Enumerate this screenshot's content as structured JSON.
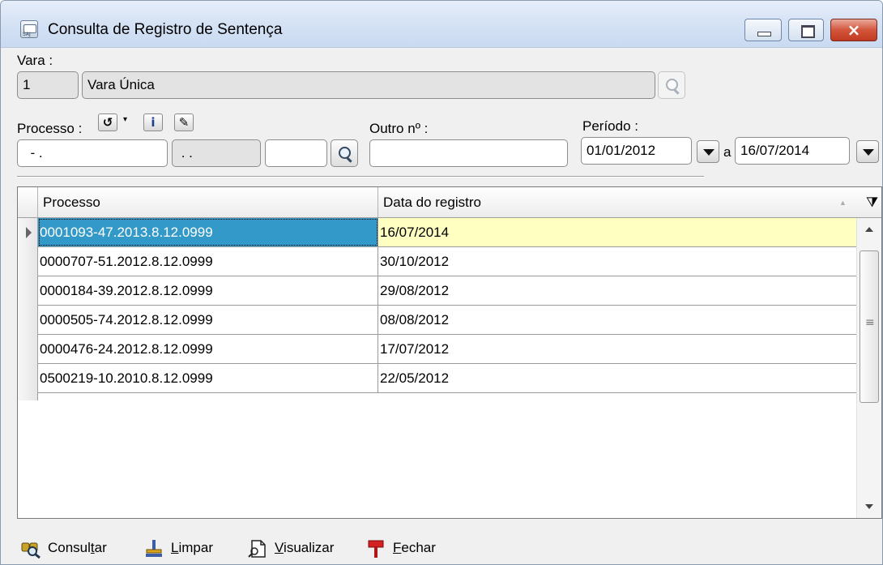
{
  "window": {
    "title": "Consulta de Registro de Sentença",
    "close_glyph": "×"
  },
  "vara": {
    "label": "Vara :",
    "code": "1",
    "name": "Vara Única"
  },
  "processo": {
    "label": "Processo :",
    "part1": "  - .",
    "part2": " . .",
    "part3": "",
    "tool_icons": [
      "undo-icon",
      "info-icon",
      "tag-icon"
    ],
    "info_glyph": "i"
  },
  "outro": {
    "label": "Outro nº :",
    "value": ""
  },
  "periodo": {
    "label": "Período :",
    "start": "01/01/2012",
    "separator": "a",
    "end": "16/07/2014"
  },
  "grid": {
    "columns": [
      "Processo",
      "Data do registro"
    ],
    "rows": [
      {
        "processo": "0001093-47.2013.8.12.0999",
        "data": "16/07/2014"
      },
      {
        "processo": "0000707-51.2012.8.12.0999",
        "data": "30/10/2012"
      },
      {
        "processo": "0000184-39.2012.8.12.0999",
        "data": "29/08/2012"
      },
      {
        "processo": "0000505-74.2012.8.12.0999",
        "data": "08/08/2012"
      },
      {
        "processo": "0000476-24.2012.8.12.0999",
        "data": "17/07/2012"
      },
      {
        "processo": "0500219-10.2010.8.12.0999",
        "data": "22/05/2012"
      }
    ],
    "selected_row": 0
  },
  "footer": {
    "consultar": {
      "pre": "Consul",
      "mnemonic": "t",
      "post": "ar"
    },
    "limpar": {
      "pre": "",
      "mnemonic": "L",
      "post": "impar"
    },
    "visualizar": {
      "pre": "",
      "mnemonic": "V",
      "post": "isualizar"
    },
    "fechar": {
      "pre": "",
      "mnemonic": "F",
      "post": "echar"
    }
  },
  "colors": {
    "selection": "#3399c8",
    "row_highlight": "#ffffc2",
    "titlebar": "#d6e3f5",
    "close_button": "#c03a20"
  }
}
